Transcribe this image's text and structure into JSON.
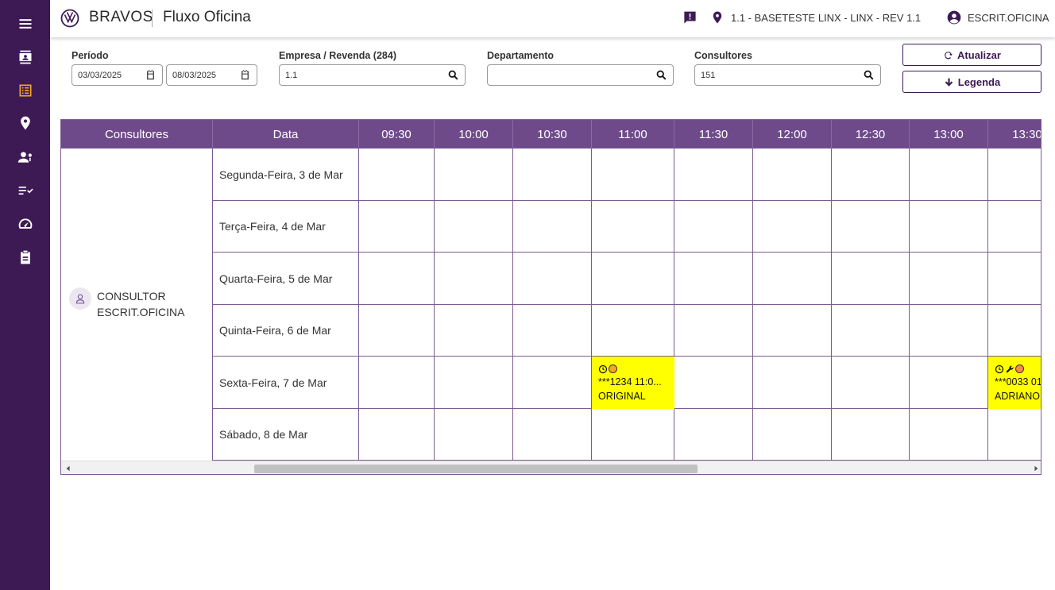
{
  "app": {
    "brand": "BRAVOS",
    "title": "Fluxo Oficina"
  },
  "topbar": {
    "location": "1.1 - BASETESTE LINX - LINX - REV 1.1",
    "user": "ESCRIT.OFICINA"
  },
  "sidebar": {
    "items": [
      {
        "name": "menu",
        "icon": "menu-icon"
      },
      {
        "name": "contacts",
        "icon": "contact-card-icon"
      },
      {
        "name": "list",
        "icon": "list-icon",
        "active": true
      },
      {
        "name": "location",
        "icon": "map-pin-icon"
      },
      {
        "name": "users",
        "icon": "user-settings-icon"
      },
      {
        "name": "checklist",
        "icon": "checklist-icon"
      },
      {
        "name": "dashboard",
        "icon": "speedometer-icon"
      },
      {
        "name": "clipboard",
        "icon": "clipboard-icon"
      }
    ]
  },
  "filters": {
    "periodo_label": "Período",
    "date_from": "03/03/2025",
    "date_to": "08/03/2025",
    "empresa_label": "Empresa / Revenda (284)",
    "empresa_value": "1.1",
    "departamento_label": "Departamento",
    "departamento_value": "",
    "consultores_label": "Consultores",
    "consultores_value": "151",
    "atualizar_label": "Atualizar",
    "legenda_label": "Legenda"
  },
  "grid": {
    "col_consultores": "Consultores",
    "col_data": "Data",
    "times": [
      "09:30",
      "10:00",
      "10:30",
      "11:00",
      "11:30",
      "12:00",
      "12:30",
      "13:00",
      "13:30"
    ],
    "consultant": {
      "line1": "CONSULTOR",
      "line2": "ESCRIT.OFICINA"
    },
    "days": [
      "Segunda-Feira, 3 de Mar",
      "Terça-Feira, 4 de Mar",
      "Quarta-Feira, 5 de Mar",
      "Quinta-Feira, 6 de Mar",
      "Sexta-Feira, 7 de Mar",
      "Sábado, 8 de Mar"
    ],
    "appointments": [
      {
        "line1": "***1234 11:0...",
        "line2": "ORIGINAL",
        "color": "#ffff00"
      },
      {
        "line1": "***0033 01",
        "line2": "ADRIANO",
        "color": "#ffff00"
      }
    ]
  },
  "colors": {
    "sidebar": "#3e1a55",
    "header": "#6f4a8b",
    "accent": "#f5a623",
    "appointment": "#ffff00"
  }
}
